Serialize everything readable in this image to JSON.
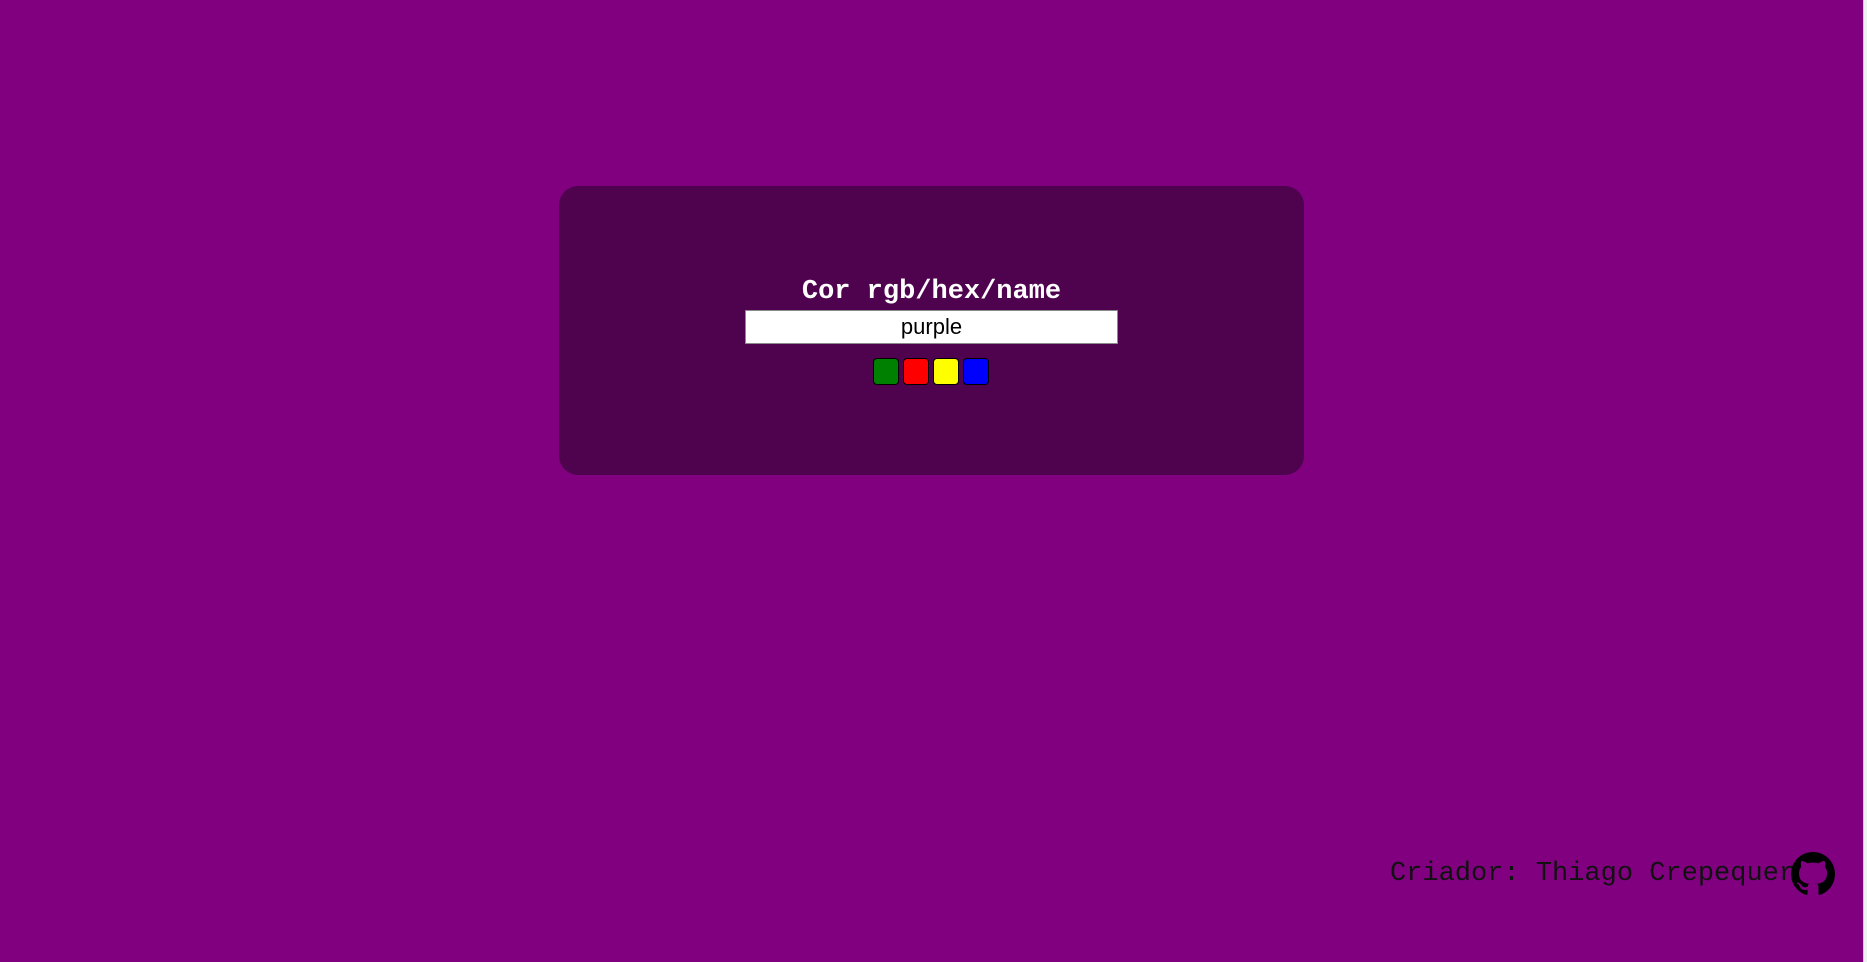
{
  "card": {
    "title": "Cor rgb/hex/name",
    "input_value": "purple"
  },
  "swatches": [
    {
      "name": "green",
      "color": "#008000"
    },
    {
      "name": "red",
      "color": "#ff0000"
    },
    {
      "name": "yellow",
      "color": "#ffff00"
    },
    {
      "name": "blue",
      "color": "#0000ff"
    }
  ],
  "footer": {
    "creator_text": "Criador: Thiago Crepequer",
    "icon": "github-icon"
  },
  "colors": {
    "page_background": "#800080",
    "card_background": "#4f034f"
  }
}
